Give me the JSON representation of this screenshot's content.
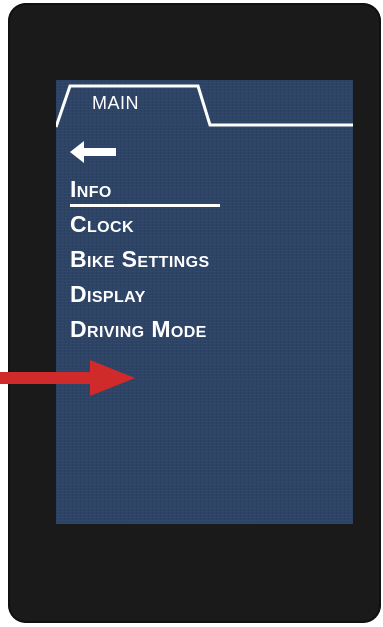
{
  "screen": {
    "tab_label": "MAIN",
    "back_icon": "left-arrow-icon",
    "menu_items": [
      {
        "label": "Info",
        "selected": true
      },
      {
        "label": "Clock",
        "selected": false
      },
      {
        "label": "Bike Settings",
        "selected": false
      },
      {
        "label": "Display",
        "selected": false
      },
      {
        "label": "Driving Mode",
        "selected": false
      }
    ]
  },
  "annotation": {
    "icon": "red-arrow-icon",
    "color": "#d12a2a"
  },
  "colors": {
    "screen_bg": "#2d4466",
    "bezel": "#1a1a1a",
    "text": "#ffffff"
  }
}
